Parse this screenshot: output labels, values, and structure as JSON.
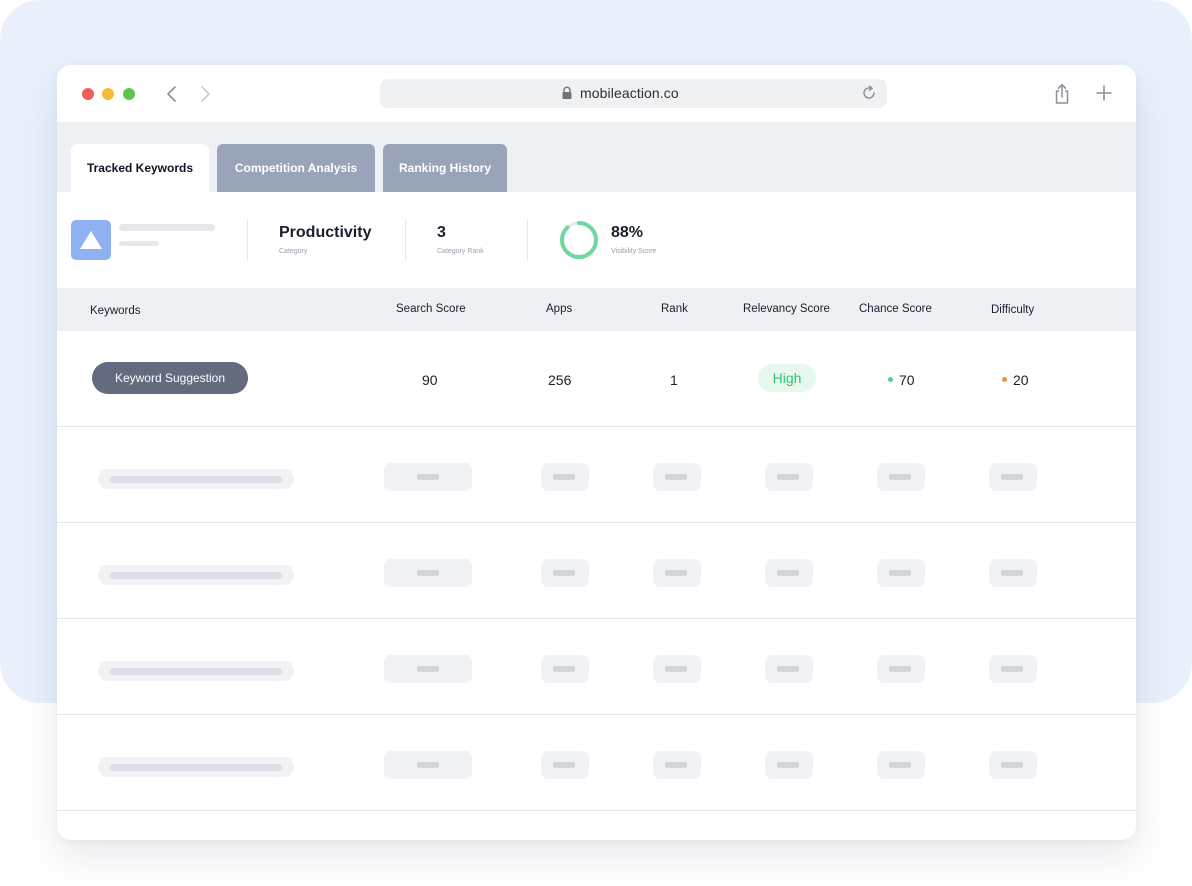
{
  "browser": {
    "url": "mobileaction.co"
  },
  "tabs": [
    {
      "label": "Tracked Keywords",
      "active": true
    },
    {
      "label": "Competition Analysis",
      "active": false
    },
    {
      "label": "Ranking History",
      "active": false
    }
  ],
  "app_info": {
    "category_value": "Productivity",
    "category_label": "Category",
    "rank_value": "3",
    "rank_label": "Category Rank",
    "visibility_value": "88%",
    "visibility_label": "Visibility Score",
    "visibility_fraction": 0.88
  },
  "table": {
    "headers": [
      "Keywords",
      "Search Score",
      "Apps",
      "Rank",
      "Relevancy Score",
      "Chance Score",
      "Difficulty"
    ],
    "first_row": {
      "keyword_button": "Keyword Suggestion",
      "search_score": "90",
      "apps": "256",
      "rank": "1",
      "relevancy": "High",
      "chance_score": "70",
      "difficulty": "20"
    },
    "placeholder_rows": 4
  },
  "colors": {
    "accent_green": "#35c472",
    "chance_dot": "#49d28a",
    "difficulty_dot": "#f0914a",
    "tab_inactive": "#9aa4b8",
    "app_icon": "#8fb1f2"
  },
  "icons": [
    "lock-icon",
    "reload-icon",
    "back-chevron-icon",
    "forward-chevron-icon",
    "share-icon",
    "plus-icon",
    "app-logo-icon"
  ]
}
